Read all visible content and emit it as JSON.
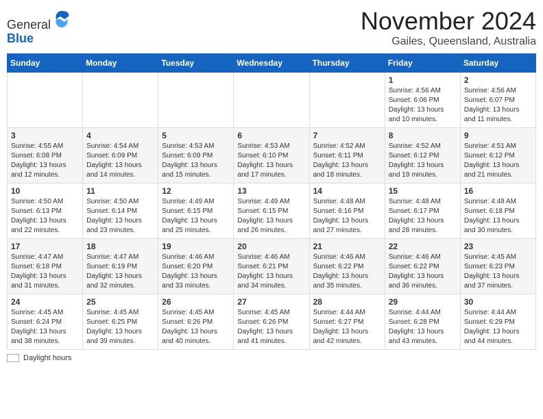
{
  "header": {
    "logo_general": "General",
    "logo_blue": "Blue",
    "month_title": "November 2024",
    "subtitle": "Gailes, Queensland, Australia"
  },
  "calendar": {
    "weekdays": [
      "Sunday",
      "Monday",
      "Tuesday",
      "Wednesday",
      "Thursday",
      "Friday",
      "Saturday"
    ],
    "weeks": [
      [
        {
          "day": "",
          "info": ""
        },
        {
          "day": "",
          "info": ""
        },
        {
          "day": "",
          "info": ""
        },
        {
          "day": "",
          "info": ""
        },
        {
          "day": "",
          "info": ""
        },
        {
          "day": "1",
          "info": "Sunrise: 4:56 AM\nSunset: 6:06 PM\nDaylight: 13 hours\nand 10 minutes."
        },
        {
          "day": "2",
          "info": "Sunrise: 4:56 AM\nSunset: 6:07 PM\nDaylight: 13 hours\nand 11 minutes."
        }
      ],
      [
        {
          "day": "3",
          "info": "Sunrise: 4:55 AM\nSunset: 6:08 PM\nDaylight: 13 hours\nand 12 minutes."
        },
        {
          "day": "4",
          "info": "Sunrise: 4:54 AM\nSunset: 6:09 PM\nDaylight: 13 hours\nand 14 minutes."
        },
        {
          "day": "5",
          "info": "Sunrise: 4:53 AM\nSunset: 6:09 PM\nDaylight: 13 hours\nand 15 minutes."
        },
        {
          "day": "6",
          "info": "Sunrise: 4:53 AM\nSunset: 6:10 PM\nDaylight: 13 hours\nand 17 minutes."
        },
        {
          "day": "7",
          "info": "Sunrise: 4:52 AM\nSunset: 6:11 PM\nDaylight: 13 hours\nand 18 minutes."
        },
        {
          "day": "8",
          "info": "Sunrise: 4:52 AM\nSunset: 6:12 PM\nDaylight: 13 hours\nand 19 minutes."
        },
        {
          "day": "9",
          "info": "Sunrise: 4:51 AM\nSunset: 6:12 PM\nDaylight: 13 hours\nand 21 minutes."
        }
      ],
      [
        {
          "day": "10",
          "info": "Sunrise: 4:50 AM\nSunset: 6:13 PM\nDaylight: 13 hours\nand 22 minutes."
        },
        {
          "day": "11",
          "info": "Sunrise: 4:50 AM\nSunset: 6:14 PM\nDaylight: 13 hours\nand 23 minutes."
        },
        {
          "day": "12",
          "info": "Sunrise: 4:49 AM\nSunset: 6:15 PM\nDaylight: 13 hours\nand 25 minutes."
        },
        {
          "day": "13",
          "info": "Sunrise: 4:49 AM\nSunset: 6:15 PM\nDaylight: 13 hours\nand 26 minutes."
        },
        {
          "day": "14",
          "info": "Sunrise: 4:48 AM\nSunset: 6:16 PM\nDaylight: 13 hours\nand 27 minutes."
        },
        {
          "day": "15",
          "info": "Sunrise: 4:48 AM\nSunset: 6:17 PM\nDaylight: 13 hours\nand 28 minutes."
        },
        {
          "day": "16",
          "info": "Sunrise: 4:48 AM\nSunset: 6:18 PM\nDaylight: 13 hours\nand 30 minutes."
        }
      ],
      [
        {
          "day": "17",
          "info": "Sunrise: 4:47 AM\nSunset: 6:18 PM\nDaylight: 13 hours\nand 31 minutes."
        },
        {
          "day": "18",
          "info": "Sunrise: 4:47 AM\nSunset: 6:19 PM\nDaylight: 13 hours\nand 32 minutes."
        },
        {
          "day": "19",
          "info": "Sunrise: 4:46 AM\nSunset: 6:20 PM\nDaylight: 13 hours\nand 33 minutes."
        },
        {
          "day": "20",
          "info": "Sunrise: 4:46 AM\nSunset: 6:21 PM\nDaylight: 13 hours\nand 34 minutes."
        },
        {
          "day": "21",
          "info": "Sunrise: 4:46 AM\nSunset: 6:22 PM\nDaylight: 13 hours\nand 35 minutes."
        },
        {
          "day": "22",
          "info": "Sunrise: 4:46 AM\nSunset: 6:22 PM\nDaylight: 13 hours\nand 36 minutes."
        },
        {
          "day": "23",
          "info": "Sunrise: 4:45 AM\nSunset: 6:23 PM\nDaylight: 13 hours\nand 37 minutes."
        }
      ],
      [
        {
          "day": "24",
          "info": "Sunrise: 4:45 AM\nSunset: 6:24 PM\nDaylight: 13 hours\nand 38 minutes."
        },
        {
          "day": "25",
          "info": "Sunrise: 4:45 AM\nSunset: 6:25 PM\nDaylight: 13 hours\nand 39 minutes."
        },
        {
          "day": "26",
          "info": "Sunrise: 4:45 AM\nSunset: 6:26 PM\nDaylight: 13 hours\nand 40 minutes."
        },
        {
          "day": "27",
          "info": "Sunrise: 4:45 AM\nSunset: 6:26 PM\nDaylight: 13 hours\nand 41 minutes."
        },
        {
          "day": "28",
          "info": "Sunrise: 4:44 AM\nSunset: 6:27 PM\nDaylight: 13 hours\nand 42 minutes."
        },
        {
          "day": "29",
          "info": "Sunrise: 4:44 AM\nSunset: 6:28 PM\nDaylight: 13 hours\nand 43 minutes."
        },
        {
          "day": "30",
          "info": "Sunrise: 4:44 AM\nSunset: 6:29 PM\nDaylight: 13 hours\nand 44 minutes."
        }
      ]
    ]
  },
  "legend": {
    "daylight_label": "Daylight hours"
  }
}
